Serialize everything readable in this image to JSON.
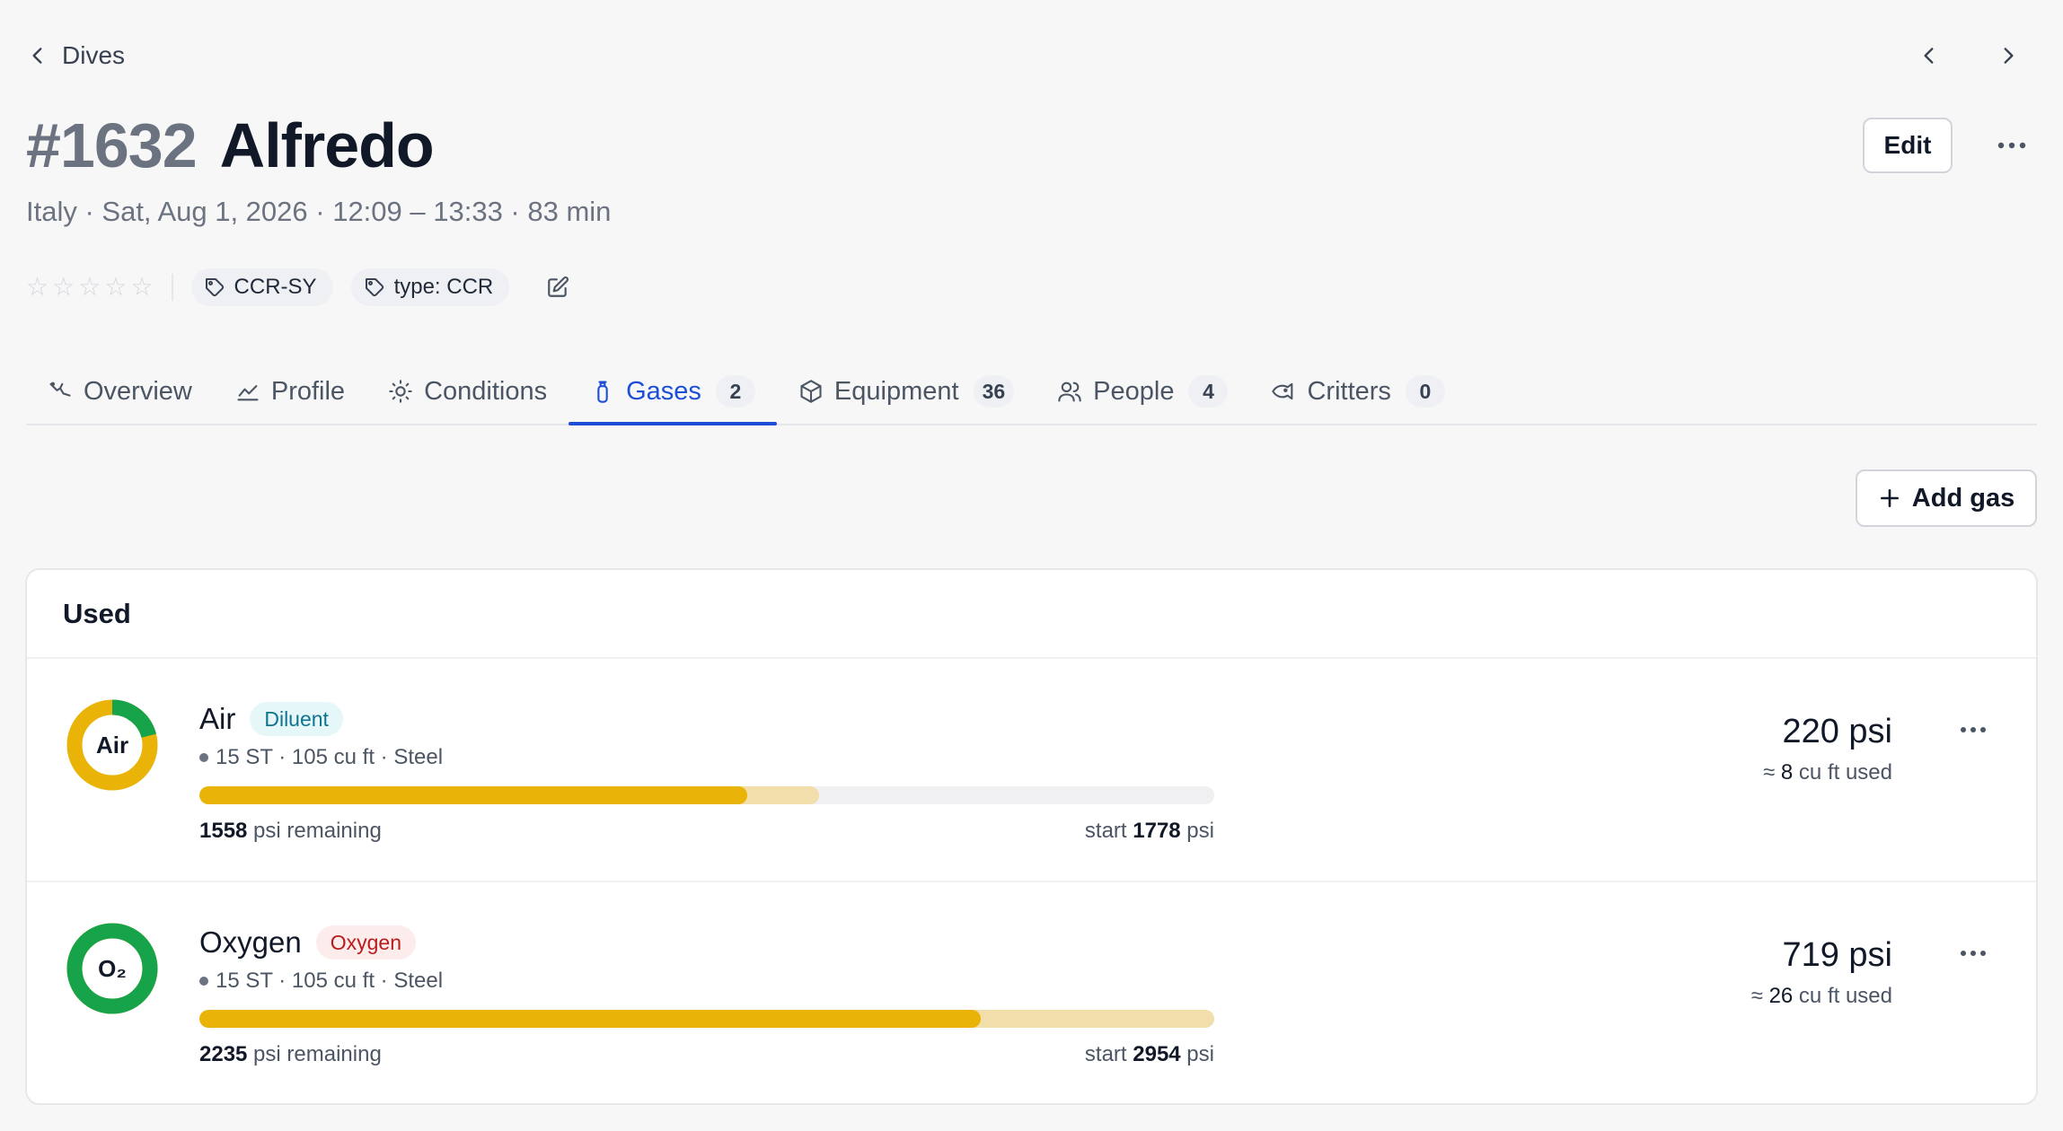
{
  "nav": {
    "back_label": "Dives"
  },
  "dive": {
    "number": "#1632",
    "name": "Alfredo",
    "subtitle": "Italy · Sat, Aug 1, 2026 · 12:09 – 13:33 · 83 min",
    "rating": 0,
    "rating_max": 5,
    "tags": [
      "CCR-SY",
      "type: CCR"
    ]
  },
  "actions": {
    "edit_label": "Edit",
    "add_gas_label": "Add gas"
  },
  "tabs": [
    {
      "label": "Overview",
      "icon": "diver-icon",
      "count": null,
      "active": false
    },
    {
      "label": "Profile",
      "icon": "chart-icon",
      "count": null,
      "active": false
    },
    {
      "label": "Conditions",
      "icon": "sun-icon",
      "count": null,
      "active": false
    },
    {
      "label": "Gases",
      "icon": "tank-icon",
      "count": "2",
      "active": true
    },
    {
      "label": "Equipment",
      "icon": "box-icon",
      "count": "36",
      "active": false
    },
    {
      "label": "People",
      "icon": "people-icon",
      "count": "4",
      "active": false
    },
    {
      "label": "Critters",
      "icon": "fish-icon",
      "count": "0",
      "active": false
    }
  ],
  "section": {
    "title": "Used"
  },
  "gases": [
    {
      "ring_label": "Air",
      "name": "Air",
      "role": "Diluent",
      "spec": "15 ST · 105 cu ft · Steel",
      "remaining_value": "1558",
      "remaining_suffix": " psi remaining",
      "start_prefix": "start ",
      "start_value": "1778",
      "start_suffix": " psi",
      "used_psi_value": "220",
      "used_psi_unit": "psi",
      "cuft_prefix": "≈ ",
      "cuft_value": "8",
      "cuft_suffix": " cu ft used",
      "o2_fraction": 0.21,
      "remaining_fraction": 0.54,
      "start_fraction": 0.611,
      "colors": {
        "ring_main": "#eab308",
        "ring_o2": "#16a34a"
      }
    },
    {
      "ring_label": "O₂",
      "name": "Oxygen",
      "role": "Oxygen",
      "spec": "15 ST · 105 cu ft · Steel",
      "remaining_value": "2235",
      "remaining_suffix": " psi remaining",
      "start_prefix": "start ",
      "start_value": "2954",
      "start_suffix": " psi",
      "used_psi_value": "719",
      "used_psi_unit": "psi",
      "cuft_prefix": "≈ ",
      "cuft_value": "26",
      "cuft_suffix": " cu ft used",
      "o2_fraction": 1.0,
      "remaining_fraction": 0.77,
      "start_fraction": 1.0,
      "colors": {
        "ring_main": "#eab308",
        "ring_o2": "#16a34a"
      }
    }
  ],
  "colors": {
    "accent": "#1d4ed8",
    "bar_remaining": "#eab308",
    "bar_used": "#f2deaa"
  }
}
